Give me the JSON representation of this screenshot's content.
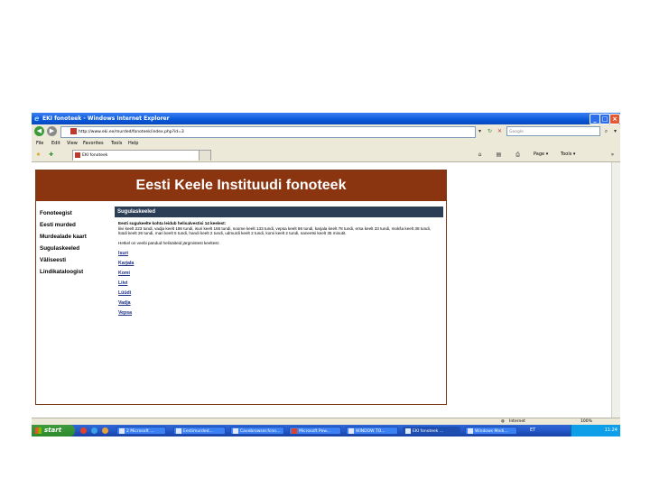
{
  "window": {
    "title": "EKI fonoteek - Windows Internet Explorer"
  },
  "address_bar": {
    "url": "http://www.eki.ee/murded/fonoteek/index.php?id=3",
    "search_placeholder": "Google"
  },
  "menu": [
    "File",
    "Edit",
    "View",
    "Favorites",
    "Tools",
    "Help"
  ],
  "tab": {
    "label": "EKI fonoteek"
  },
  "toolbar": {
    "page_label": "Page",
    "tools_label": "Tools"
  },
  "site": {
    "banner_title": "Eesti Keele Instituudi fonoteek",
    "nav": [
      "Fonoteegist",
      "Eesti murded",
      "Murdealade kaart",
      "Sugulaskeeled",
      "Väliseesti",
      "Lindikataloogist"
    ],
    "page_heading": "Sugulaskeeled",
    "intro_bold": "Eesti sugukeelte kohta leidub helisalvestisi 14 keelest:",
    "intro_text": "liivi keelt 223 tundi, vadja keelt 186 tundi, isuri keelt 165 tundi, soome keelt 133 tundi, vepsa keelt 86 tundi, karjala keelt 78 tundi, ersa keelt 33 tundi, mokša keelt 38 tundi, lüüdi keelt 26 tundi, mari keelt 5 tundi, handi keelt 2 tundi, udmurdi keelt 2 tundi, komi keelt 2 tundi, naneetsi keelt 35 minutit.",
    "subheading": "Hetkel on veebi pandud helinäiteid järgmistest keeltest:",
    "languages": [
      "Isuri",
      "Karjala",
      "Komi",
      "Liivi",
      "Lüüdi",
      "Vadja",
      "Vepsa"
    ]
  },
  "statusbar": {
    "zone": "Internet",
    "zoom": "100%"
  },
  "taskbar": {
    "start_label": "start",
    "buttons": [
      "2 Microsoft ...",
      "Eestimurded...",
      "Cavebrowser.fcnn...",
      "Microsoft Pow...",
      "WINDOW TO...",
      "EKI fonoteek ...",
      "Windows Medi..."
    ],
    "lang": "ET",
    "clock": "11:24"
  }
}
